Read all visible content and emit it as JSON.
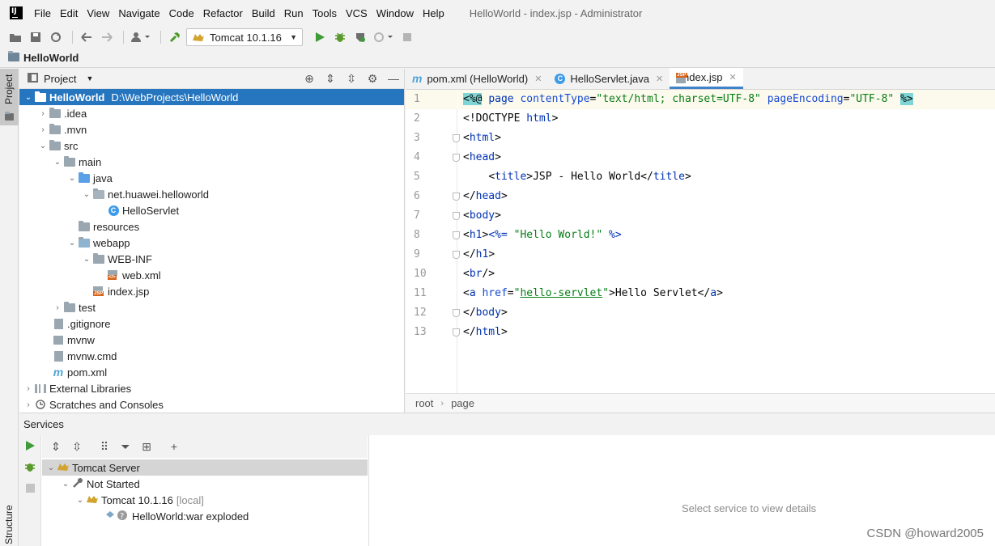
{
  "menubar": {
    "items": [
      "File",
      "Edit",
      "View",
      "Navigate",
      "Code",
      "Refactor",
      "Build",
      "Run",
      "Tools",
      "VCS",
      "Window",
      "Help"
    ],
    "window_title": "HelloWorld - index.jsp - Administrator"
  },
  "toolbar": {
    "run_config": "Tomcat 10.1.16"
  },
  "navbar": {
    "project": "HelloWorld"
  },
  "left_stripe": {
    "project_tab": "Project",
    "structure_tab": "Structure"
  },
  "project_panel": {
    "title": "Project",
    "tree": [
      {
        "label": "HelloWorld",
        "path": "D:\\WebProjects\\HelloWorld"
      },
      {
        "label": ".idea"
      },
      {
        "label": ".mvn"
      },
      {
        "label": "src"
      },
      {
        "label": "main"
      },
      {
        "label": "java"
      },
      {
        "label": "net.huawei.helloworld"
      },
      {
        "label": "HelloServlet"
      },
      {
        "label": "resources"
      },
      {
        "label": "webapp"
      },
      {
        "label": "WEB-INF"
      },
      {
        "label": "web.xml"
      },
      {
        "label": "index.jsp"
      },
      {
        "label": "test"
      },
      {
        "label": ".gitignore"
      },
      {
        "label": "mvnw"
      },
      {
        "label": "mvnw.cmd"
      },
      {
        "label": "pom.xml"
      },
      {
        "label": "External Libraries"
      },
      {
        "label": "Scratches and Consoles"
      }
    ]
  },
  "editor": {
    "tabs": [
      {
        "label": "pom.xml (HelloWorld)"
      },
      {
        "label": "HelloServlet.java"
      },
      {
        "label": "index.jsp"
      }
    ],
    "line_numbers": [
      "1",
      "2",
      "3",
      "4",
      "5",
      "6",
      "7",
      "8",
      "9",
      "10",
      "11",
      "12",
      "13"
    ],
    "code": {
      "l1": {
        "open": "<%@",
        "k1": "page",
        "a1": "contentType",
        "eq1": "=",
        "v1": "\"text/html; charset=UTF-8\"",
        "a2": "pageEncoding",
        "eq2": "=",
        "v2": "\"UTF-8\"",
        "close": "%>"
      },
      "l2": {
        "t1": "<!DOCTYPE",
        "t2": "html",
        "t3": ">"
      },
      "l3": {
        "o": "<",
        "t": "html",
        "c": ">"
      },
      "l4": {
        "o": "<",
        "t": "head",
        "c": ">"
      },
      "l5": {
        "indent": "    ",
        "o1": "<",
        "t1": "title",
        "c1": ">",
        "text": "JSP - Hello World",
        "o2": "</",
        "t2": "title",
        "c2": ">"
      },
      "l6": {
        "o": "</",
        "t": "head",
        "c": ">"
      },
      "l7": {
        "o": "<",
        "t": "body",
        "c": ">"
      },
      "l8": {
        "o": "<",
        "t": "h1",
        "c": ">",
        "sopen": "<%=",
        "s": "\"Hello World!\"",
        "sclose": "%>"
      },
      "l9": {
        "o": "</",
        "t": "h1",
        "c": ">"
      },
      "l10": {
        "o": "<",
        "t": "br",
        "c": "/>"
      },
      "l11": {
        "o": "<",
        "t": "a",
        "a": "href",
        "eq": "=",
        "q1": "\"",
        "v": "hello-servlet",
        "q2": "\"",
        "c": ">",
        "text": "Hello Servlet",
        "o2": "</",
        "t2": "a",
        "c2": ">"
      },
      "l12": {
        "o": "</",
        "t": "body",
        "c": ">"
      },
      "l13": {
        "o": "</",
        "t": "html",
        "c": ">"
      }
    },
    "breadcrumb": [
      "root",
      "page"
    ]
  },
  "services": {
    "title": "Services",
    "tree": [
      {
        "label": "Tomcat Server"
      },
      {
        "label": "Not Started"
      },
      {
        "label": "Tomcat 10.1.16",
        "suffix": "[local]"
      },
      {
        "label": "HelloWorld:war exploded"
      }
    ],
    "placeholder": "Select service to view details",
    "watermark": "CSDN @howard2005"
  },
  "colors": {
    "selection": "#2675bf",
    "accent": "#4083c9"
  }
}
